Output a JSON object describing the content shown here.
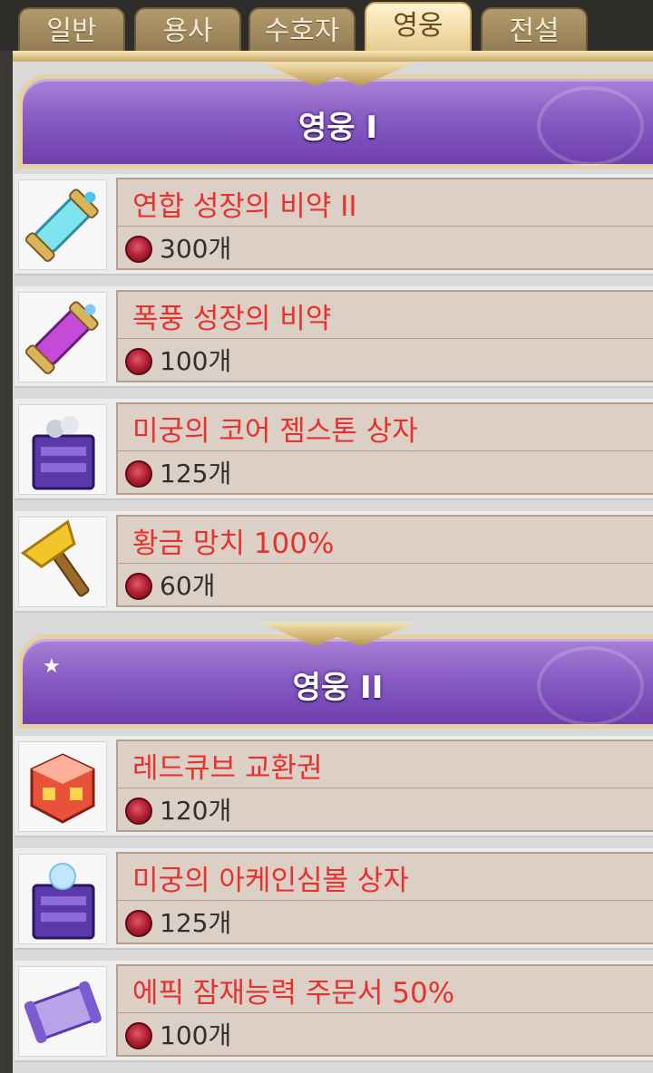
{
  "tabs": [
    {
      "label": "일반",
      "active": false
    },
    {
      "label": "용사",
      "active": false
    },
    {
      "label": "수호자",
      "active": false
    },
    {
      "label": "영웅",
      "active": true
    },
    {
      "label": "전설",
      "active": false
    }
  ],
  "sections": [
    {
      "title": "영웅 I",
      "items": [
        {
          "name": "연합 성장의 비약 II",
          "price": "300개",
          "icon": "blue-potion-scroll-icon"
        },
        {
          "name": "폭풍 성장의 비약",
          "price": "100개",
          "icon": "purple-potion-scroll-icon"
        },
        {
          "name": "미궁의 코어 젬스톤 상자",
          "price": "125개",
          "icon": "gemstone-box-icon"
        },
        {
          "name": "황금 망치 100%",
          "price": "60개",
          "icon": "golden-hammer-icon"
        }
      ]
    },
    {
      "title": "영웅 II",
      "items": [
        {
          "name": "레드큐브 교환권",
          "price": "120개",
          "icon": "red-cube-icon"
        },
        {
          "name": "미궁의 아케인심볼 상자",
          "price": "125개",
          "icon": "arcane-symbol-box-icon"
        },
        {
          "name": "에픽 잠재능력 주문서 50%",
          "price": "100개",
          "icon": "epic-scroll-icon"
        }
      ]
    }
  ],
  "colors": {
    "accent_purple": "#8a5cc4",
    "item_name_red": "#e8312d",
    "currency_red": "#b01e32"
  }
}
